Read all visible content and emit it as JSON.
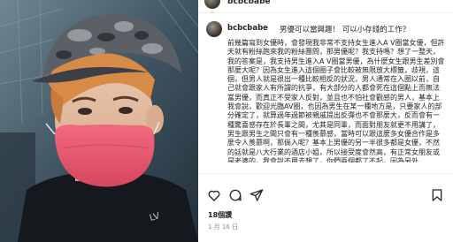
{
  "post": {
    "username": "bcbcbabe",
    "caption_username": "bcbcbabe",
    "caption_title": "男優可以當興趣！ 可以小存錢的工作？",
    "caption_body": "前幾篇寫到女優時，會發現我非常不支持女生進入A V圈當女優，但許天就有粉絲跑來我的粉絲團問，那男優呢？我支持嗎？想了一整天，我的答案是，我支持男生進入A V圈當男優，為什麼女生跟男生差別會那麼大呢？因為女生進入這個圈子會比較被無限放大標籤，歧視，這個，但男人就是很出一種比較相反的狀況，男人通常在入圈以前，自己就會跟家人有所謂的抗爭，有大部分的人都會死在這個點上而無法當男優，而真正不受家人反對，並且也不怕社會觀感的男人，基本上我會說，歡迎光臨AV圈，也因為男生在某一種地方是，只要家人的部分確定了，就算過年過節被親戚提出反彈也不會那麼大，反而會有一種驚喜感存在於長輩之間，尤其是同輩，而面對朋友就更不用講了，男生跟男生之間只會有一種羨慕感，當時可以跟這麼多女優合作是多麼令人羨慕啊，那倘入呢？基本上男優的另一半很多都是女優，不然的話就是八大行業的酒店小姐，所以接受度會然高，有正常女朋友或是老婆的，我會說不用去想了，你們兩個都了不起，因為另外",
    "likes": "18個讚",
    "date": "1 月 16 日"
  },
  "icons": {
    "like": "heart-icon",
    "comment": "comment-bubble-icon",
    "share": "paper-plane-icon",
    "save": "bookmark-icon"
  },
  "colors": {
    "text": "#262626",
    "muted": "#8e8e8e",
    "divider": "#efefef",
    "mask": "#e8576e"
  }
}
